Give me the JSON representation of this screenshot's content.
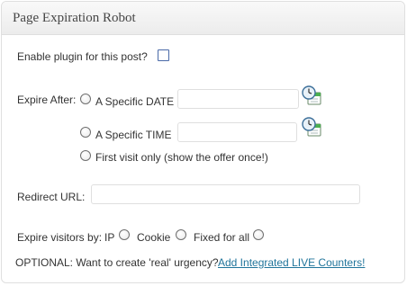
{
  "panel": {
    "title": "Page Expiration Robot"
  },
  "enable": {
    "label": "Enable plugin for this post?",
    "checked": false
  },
  "expire_after": {
    "label": "Expire After:",
    "options": [
      {
        "label": "A Specific DATE",
        "value": "",
        "has_field": true
      },
      {
        "label": "A Specific TIME",
        "value": "",
        "has_field": true
      },
      {
        "label": "First visit only (show the offer once!)",
        "has_field": false
      }
    ]
  },
  "redirect": {
    "label": "Redirect URL:",
    "value": ""
  },
  "expire_visitors": {
    "label": "Expire visitors by:",
    "options": [
      "IP",
      "Cookie",
      "Fixed for all"
    ]
  },
  "optional": {
    "text": "OPTIONAL: Want to create 'real' urgency?",
    "link_label": "Add Integrated LIVE Counters!"
  },
  "icons": {
    "date_picker": "calendar-clock-icon",
    "time_picker": "calendar-clock-icon"
  },
  "colors": {
    "link": "#21759b",
    "header_bg": "#ececec",
    "border": "#dfdfdf"
  }
}
